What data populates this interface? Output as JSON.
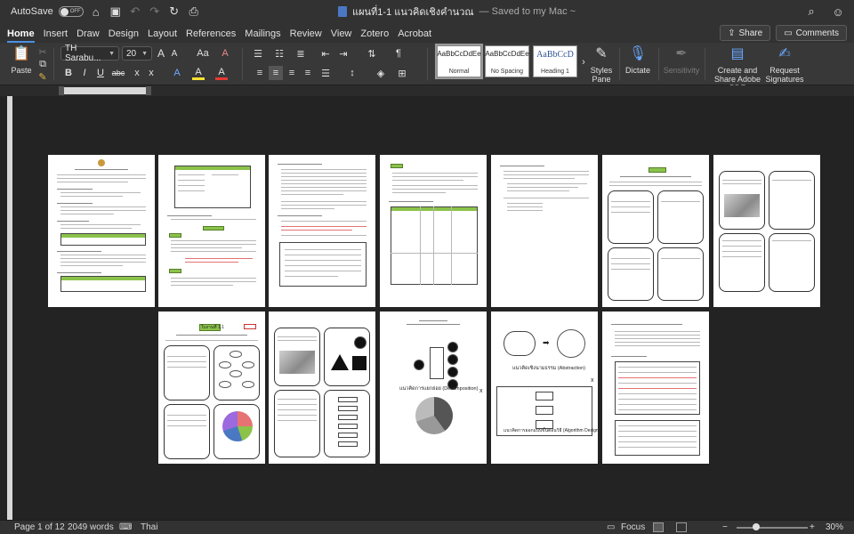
{
  "titlebar": {
    "autosave_label": "AutoSave",
    "autosave_state": "OFF",
    "doc_title": "แผนที่1-1 แนวคิดเชิงคำนวณ",
    "saved_status": "— Saved to my Mac ~",
    "icons": [
      "home-icon",
      "save-icon",
      "undo-icon",
      "redo-icon",
      "repeat-icon",
      "print-icon",
      "search-icon",
      "account-icon"
    ]
  },
  "tabs": [
    "Home",
    "Insert",
    "Draw",
    "Design",
    "Layout",
    "References",
    "Mailings",
    "Review",
    "View",
    "Zotero",
    "Acrobat"
  ],
  "active_tab": "Home",
  "share_label": "Share",
  "comments_label": "Comments",
  "ribbon": {
    "paste_label": "Paste",
    "font_name": "TH Sarabu...",
    "font_size": "20",
    "grow_font": "A",
    "shrink_font": "A",
    "change_case": "Aa",
    "clear_format": "A",
    "bold": "B",
    "italic": "I",
    "underline": "U",
    "strike": "abc",
    "subscript": "x",
    "superscript": "x",
    "text_effects": "A",
    "highlight": "A",
    "font_color": "A",
    "pilcrow": "¶",
    "styles": [
      {
        "sample": "AaBbCcDdEe",
        "name": "Normal"
      },
      {
        "sample": "AaBbCcDdEe",
        "name": "No Spacing"
      },
      {
        "sample": "AaBbCcD",
        "name": "Heading 1"
      }
    ],
    "styles_pane_label": "Styles Pane",
    "dictate_label": "Dictate",
    "sensitivity_label": "Sensitivity",
    "create_share_label": "Create and Share Adobe PDF",
    "request_sig_label": "Request Signatures"
  },
  "pages": {
    "p8_title": "ใบงานที่ 1.1",
    "p10_decomposition": "แนวคิดการแยกย่อย (Decomposition)",
    "p11_abstraction": "แนวคิดเชิงนามธรรม (Abstraction)",
    "p11_algorithm": "แนวคิดการออกแบบขั้นตอนวิธี (Algorithm Design)"
  },
  "statusbar": {
    "page_info": "Page 1 of 12",
    "word_count": "2049 words",
    "language": "Thai",
    "focus_label": "Focus",
    "zoom": "30%"
  },
  "colors": {
    "accent": "#4a90e2",
    "green_highlight": "#8bc34a",
    "app_bg": "#2b2b2b"
  }
}
